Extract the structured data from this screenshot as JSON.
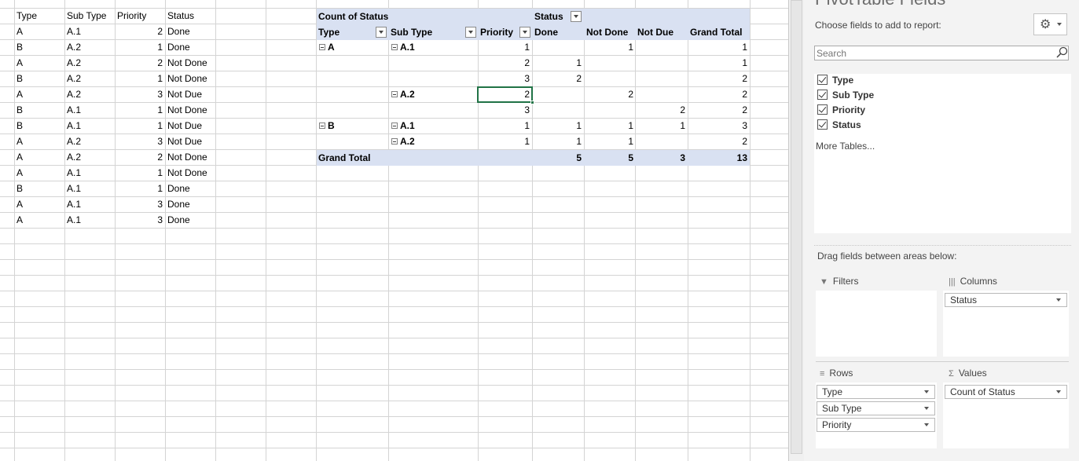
{
  "source_table": {
    "headers": [
      "Type",
      "Sub Type",
      "Priority",
      "Status"
    ],
    "rows": [
      [
        "A",
        "A.1",
        "2",
        "Done"
      ],
      [
        "B",
        "A.2",
        "1",
        "Done"
      ],
      [
        "A",
        "A.2",
        "2",
        "Not Done"
      ],
      [
        "B",
        "A.2",
        "1",
        "Not Done"
      ],
      [
        "A",
        "A.2",
        "3",
        "Not Due"
      ],
      [
        "B",
        "A.1",
        "1",
        "Not Done"
      ],
      [
        "B",
        "A.1",
        "1",
        "Not Due"
      ],
      [
        "A",
        "A.2",
        "3",
        "Not Due"
      ],
      [
        "A",
        "A.2",
        "2",
        "Not Done"
      ],
      [
        "A",
        "A.1",
        "1",
        "Not Done"
      ],
      [
        "B",
        "A.1",
        "1",
        "Done"
      ],
      [
        "A",
        "A.1",
        "3",
        "Done"
      ],
      [
        "A",
        "A.1",
        "3",
        "Done"
      ]
    ]
  },
  "pivot": {
    "value_header": "Count of Status",
    "column_field": "Status",
    "row_headers": [
      "Type",
      "Sub Type",
      "Priority"
    ],
    "column_headers": [
      "Done",
      "Not Done",
      "Not Due",
      "Grand Total"
    ],
    "rows": [
      {
        "type": "A",
        "subtype": "A.1",
        "priority": "1",
        "done": "",
        "notdone": "1",
        "notdue": "",
        "total": "1"
      },
      {
        "type": "",
        "subtype": "",
        "priority": "2",
        "done": "1",
        "notdone": "",
        "notdue": "",
        "total": "1"
      },
      {
        "type": "",
        "subtype": "",
        "priority": "3",
        "done": "2",
        "notdone": "",
        "notdue": "",
        "total": "2"
      },
      {
        "type": "",
        "subtype": "A.2",
        "priority": "2",
        "done": "",
        "notdone": "2",
        "notdue": "",
        "total": "2"
      },
      {
        "type": "",
        "subtype": "",
        "priority": "3",
        "done": "",
        "notdone": "",
        "notdue": "2",
        "total": "2"
      },
      {
        "type": "B",
        "subtype": "A.1",
        "priority": "1",
        "done": "1",
        "notdone": "1",
        "notdue": "1",
        "total": "3"
      },
      {
        "type": "",
        "subtype": "A.2",
        "priority": "1",
        "done": "1",
        "notdone": "1",
        "notdue": "",
        "total": "2"
      }
    ],
    "grand_total": {
      "label": "Grand Total",
      "done": "5",
      "notdone": "5",
      "notdue": "3",
      "total": "13"
    }
  },
  "panel": {
    "title": "PivotTable Fields",
    "choose_label": "Choose fields to add to report:",
    "gear_icon": "gear-icon",
    "search_placeholder": "Search",
    "fields": [
      "Type",
      "Sub Type",
      "Priority",
      "Status"
    ],
    "more_tables": "More Tables...",
    "drag_label": "Drag fields between areas below:",
    "filters_label": "Filters",
    "columns_label": "Columns",
    "rows_label": "Rows",
    "values_label": "Values",
    "columns_items": [
      "Status"
    ],
    "rows_items": [
      "Type",
      "Sub Type",
      "Priority"
    ],
    "values_items": [
      "Count of Status"
    ]
  },
  "colors": {
    "pivot_header": "#d9e1f2",
    "selection": "#217346",
    "gridline": "#d4d4d4",
    "panel_bg": "#f3f3f3"
  }
}
